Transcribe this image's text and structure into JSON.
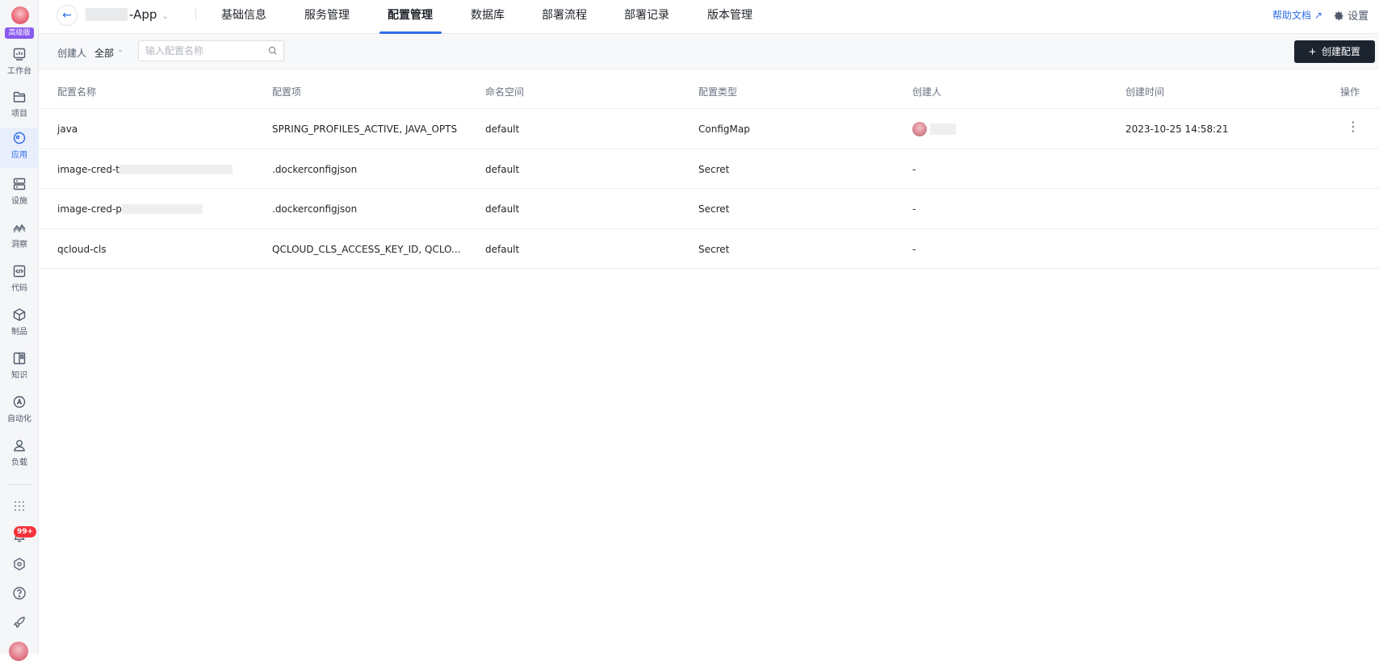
{
  "sidebar": {
    "logo_tag": "高级版",
    "items": [
      {
        "label": "工作台",
        "icon": "dashboard-icon"
      },
      {
        "label": "项目",
        "icon": "folder-icon"
      },
      {
        "label": "应用",
        "icon": "app-icon",
        "active": true
      },
      {
        "label": "设施",
        "icon": "server-icon"
      },
      {
        "label": "洞察",
        "icon": "insight-icon"
      },
      {
        "label": "代码",
        "icon": "code-icon"
      },
      {
        "label": "制品",
        "icon": "package-icon"
      },
      {
        "label": "知识",
        "icon": "book-icon"
      },
      {
        "label": "自动化",
        "icon": "automation-icon"
      },
      {
        "label": "负载",
        "icon": "user-icon"
      }
    ],
    "notification_badge": "99+"
  },
  "header": {
    "app_name": "-App",
    "tabs": [
      {
        "label": "基础信息"
      },
      {
        "label": "服务管理"
      },
      {
        "label": "配置管理",
        "active": true
      },
      {
        "label": "数据库"
      },
      {
        "label": "部署流程"
      },
      {
        "label": "部署记录"
      },
      {
        "label": "版本管理"
      }
    ],
    "help_label": "帮助文档",
    "settings_label": "设置"
  },
  "filter": {
    "creator_label": "创建人",
    "creator_value": "全部",
    "search_placeholder": "输入配置名称",
    "create_button_label": "创建配置"
  },
  "table": {
    "columns": [
      "配置名称",
      "配置项",
      "命名空间",
      "配置类型",
      "创建人",
      "创建时间",
      "操作"
    ],
    "rows": [
      {
        "name": "java",
        "items": "SPRING_PROFILES_ACTIVE, JAVA_OPTS",
        "namespace": "default",
        "type": "ConfigMap",
        "creator": "",
        "created": "2023-10-25 14:58:21",
        "has_actions": true
      },
      {
        "name": "image-cred-t",
        "items": ".dockerconfigjson",
        "namespace": "default",
        "type": "Secret",
        "creator": "-",
        "created": "",
        "has_actions": false
      },
      {
        "name": "image-cred-p",
        "items": ".dockerconfigjson",
        "namespace": "default",
        "type": "Secret",
        "creator": "-",
        "created": "",
        "has_actions": false
      },
      {
        "name": "qcloud-cls",
        "items": "QCLOUD_CLS_ACCESS_KEY_ID, QCLO...",
        "namespace": "default",
        "type": "Secret",
        "creator": "-",
        "created": "",
        "has_actions": false
      }
    ]
  },
  "colors": {
    "accent": "#2f6de8",
    "primary_button": "#1c2430",
    "badge": "#f5323c",
    "edition_tag": "#8a59f0"
  }
}
